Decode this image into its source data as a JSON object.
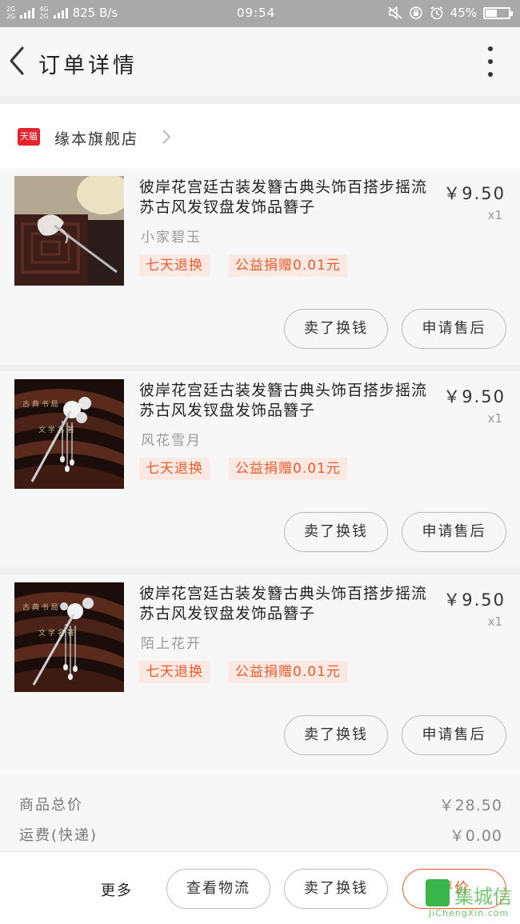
{
  "status_bar": {
    "net_top": "2G",
    "net_bottom": "2G",
    "net2_top": "4G",
    "net2_bottom": "2G",
    "speed": "825 B/s",
    "time": "09:54",
    "battery_text": "45%",
    "battery_level": 0.45
  },
  "header": {
    "title": "订单详情",
    "back_icon": "chevron-left-icon",
    "more_icon": "more-vertical-icon"
  },
  "store": {
    "badge": "天猫",
    "name": "缘本旗舰店",
    "chevron_icon": "chevron-right-icon"
  },
  "items": [
    {
      "title": "彼岸花宫廷古装发簪古典头饰百搭步摇流苏古风发钗盘发饰品簪子",
      "sku": "小家碧玉",
      "price": "￥9.50",
      "qty": "x1",
      "tags": [
        "七天退换",
        "公益捐赠0.01元"
      ],
      "buttons": [
        "卖了换钱",
        "申请售后"
      ]
    },
    {
      "title": "彼岸花宫廷古装发簪古典头饰百搭步摇流苏古风发钗盘发饰品簪子",
      "sku": "风花雪月",
      "price": "￥9.50",
      "qty": "x1",
      "tags": [
        "七天退换",
        "公益捐赠0.01元"
      ],
      "buttons": [
        "卖了换钱",
        "申请售后"
      ]
    },
    {
      "title": "彼岸花宫廷古装发簪古典头饰百搭步摇流苏古风发钗盘发饰品簪子",
      "sku": "陌上花开",
      "price": "￥9.50",
      "qty": "x1",
      "tags": [
        "七天退换",
        "公益捐赠0.01元"
      ],
      "buttons": [
        "卖了换钱",
        "申请售后"
      ]
    }
  ],
  "summary": {
    "total_label": "商品总价",
    "total_value": "￥28.50",
    "shipping_label": "运费(快递)",
    "shipping_value": "￥0.00"
  },
  "footer": {
    "more": "更多",
    "logistics": "查看物流",
    "sell": "卖了换钱",
    "rate": "评价"
  },
  "watermark": {
    "text": "集城信",
    "sub": "JiChengXin.com"
  },
  "colors": {
    "accent": "#f25a2a",
    "tag_bg": "#fde9e4",
    "tmall_red": "#e5232d",
    "status_bar": "#a9a9a9"
  }
}
